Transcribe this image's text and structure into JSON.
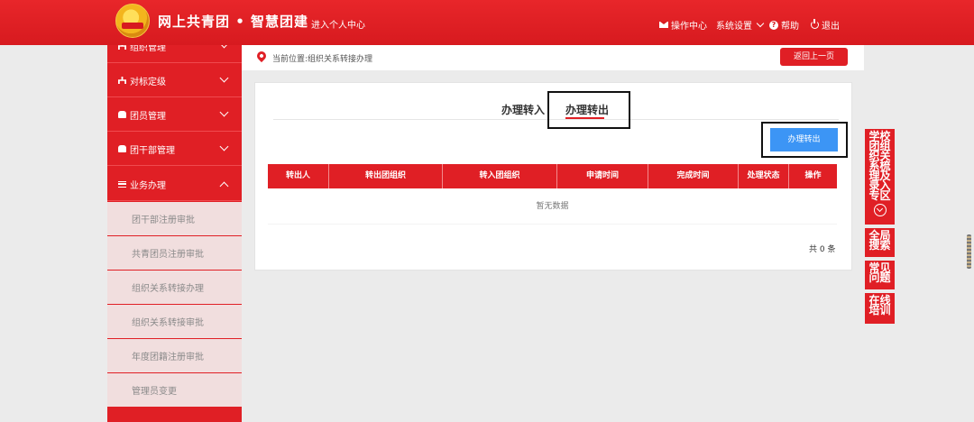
{
  "header": {
    "title": "网上共青团 • 智慧团建",
    "personal_center": "进入个人中心",
    "operation_center": "操作中心",
    "system_settings": "系统设置",
    "help": "帮助",
    "logout": "退出"
  },
  "sidebar": {
    "items": [
      {
        "label": "组织管理"
      },
      {
        "label": "对标定级"
      },
      {
        "label": "团员管理"
      },
      {
        "label": "团干部管理"
      },
      {
        "label": "业务办理"
      }
    ],
    "sub_items": [
      {
        "label": "团干部注册审批"
      },
      {
        "label": "共青团员注册审批"
      },
      {
        "label": "组织关系转接办理"
      },
      {
        "label": "组织关系转接审批"
      },
      {
        "label": "年度团籍注册审批"
      },
      {
        "label": "管理员变更"
      }
    ]
  },
  "breadcrumb": {
    "text": "当前位置:组织关系转接办理",
    "back_button": "返回上一页"
  },
  "main": {
    "tabs": [
      {
        "label": "办理转入"
      },
      {
        "label": "办理转出"
      }
    ],
    "action_button": "办理转出",
    "table": {
      "columns": [
        "转出人",
        "转出团组织",
        "转入团组织",
        "申请时间",
        "完成时间",
        "处理状态",
        "操作"
      ],
      "empty_text": "暂无数据",
      "total": "共 0 条"
    }
  },
  "floating": {
    "school_zone": "学校团组织关系梳理及录入专区",
    "global_search": "全局搜索",
    "faq": "常见问题",
    "online_training": "在线培训"
  },
  "colors": {
    "brand_red": "#e01f25",
    "button_blue": "#3c95f5"
  }
}
